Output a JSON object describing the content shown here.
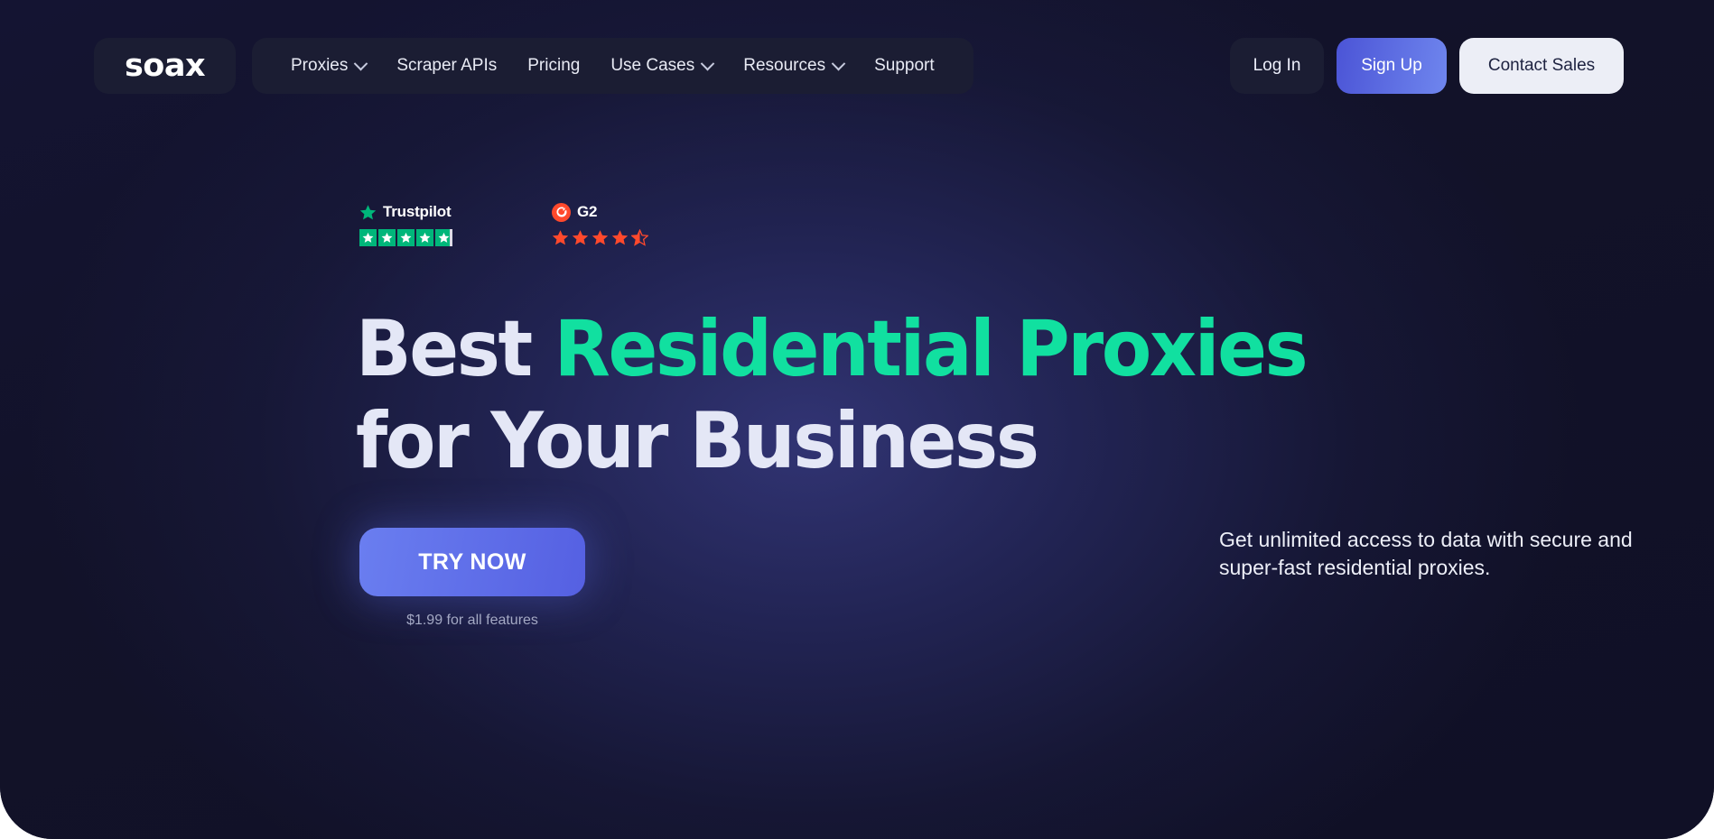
{
  "header": {
    "logo": "soax",
    "nav": [
      {
        "label": "Proxies",
        "has_chevron": true
      },
      {
        "label": "Scraper APIs",
        "has_chevron": false
      },
      {
        "label": "Pricing",
        "has_chevron": false
      },
      {
        "label": "Use Cases",
        "has_chevron": true
      },
      {
        "label": "Resources",
        "has_chevron": true
      },
      {
        "label": "Support",
        "has_chevron": false
      }
    ],
    "login_label": "Log In",
    "signup_label": "Sign Up",
    "contact_label": "Contact Sales"
  },
  "badges": {
    "trustpilot": {
      "name": "Trustpilot",
      "stars_filled": 4,
      "stars_partial": 0.85,
      "stars_total": 5,
      "color": "#00b67a"
    },
    "g2": {
      "name": "G2",
      "stars_filled": 4,
      "stars_partial": 0.5,
      "stars_total": 5,
      "color": "#ff492c"
    }
  },
  "hero": {
    "headline_line1_plain": "Best ",
    "headline_line1_accent": "Residential Proxies",
    "headline_line2": "for Your Business",
    "accent_color": "#11e0a0",
    "cta_label": "TRY NOW",
    "cta_note": "$1.99 for all features",
    "description": "Get unlimited access to data with secure and super-fast residential proxies."
  }
}
